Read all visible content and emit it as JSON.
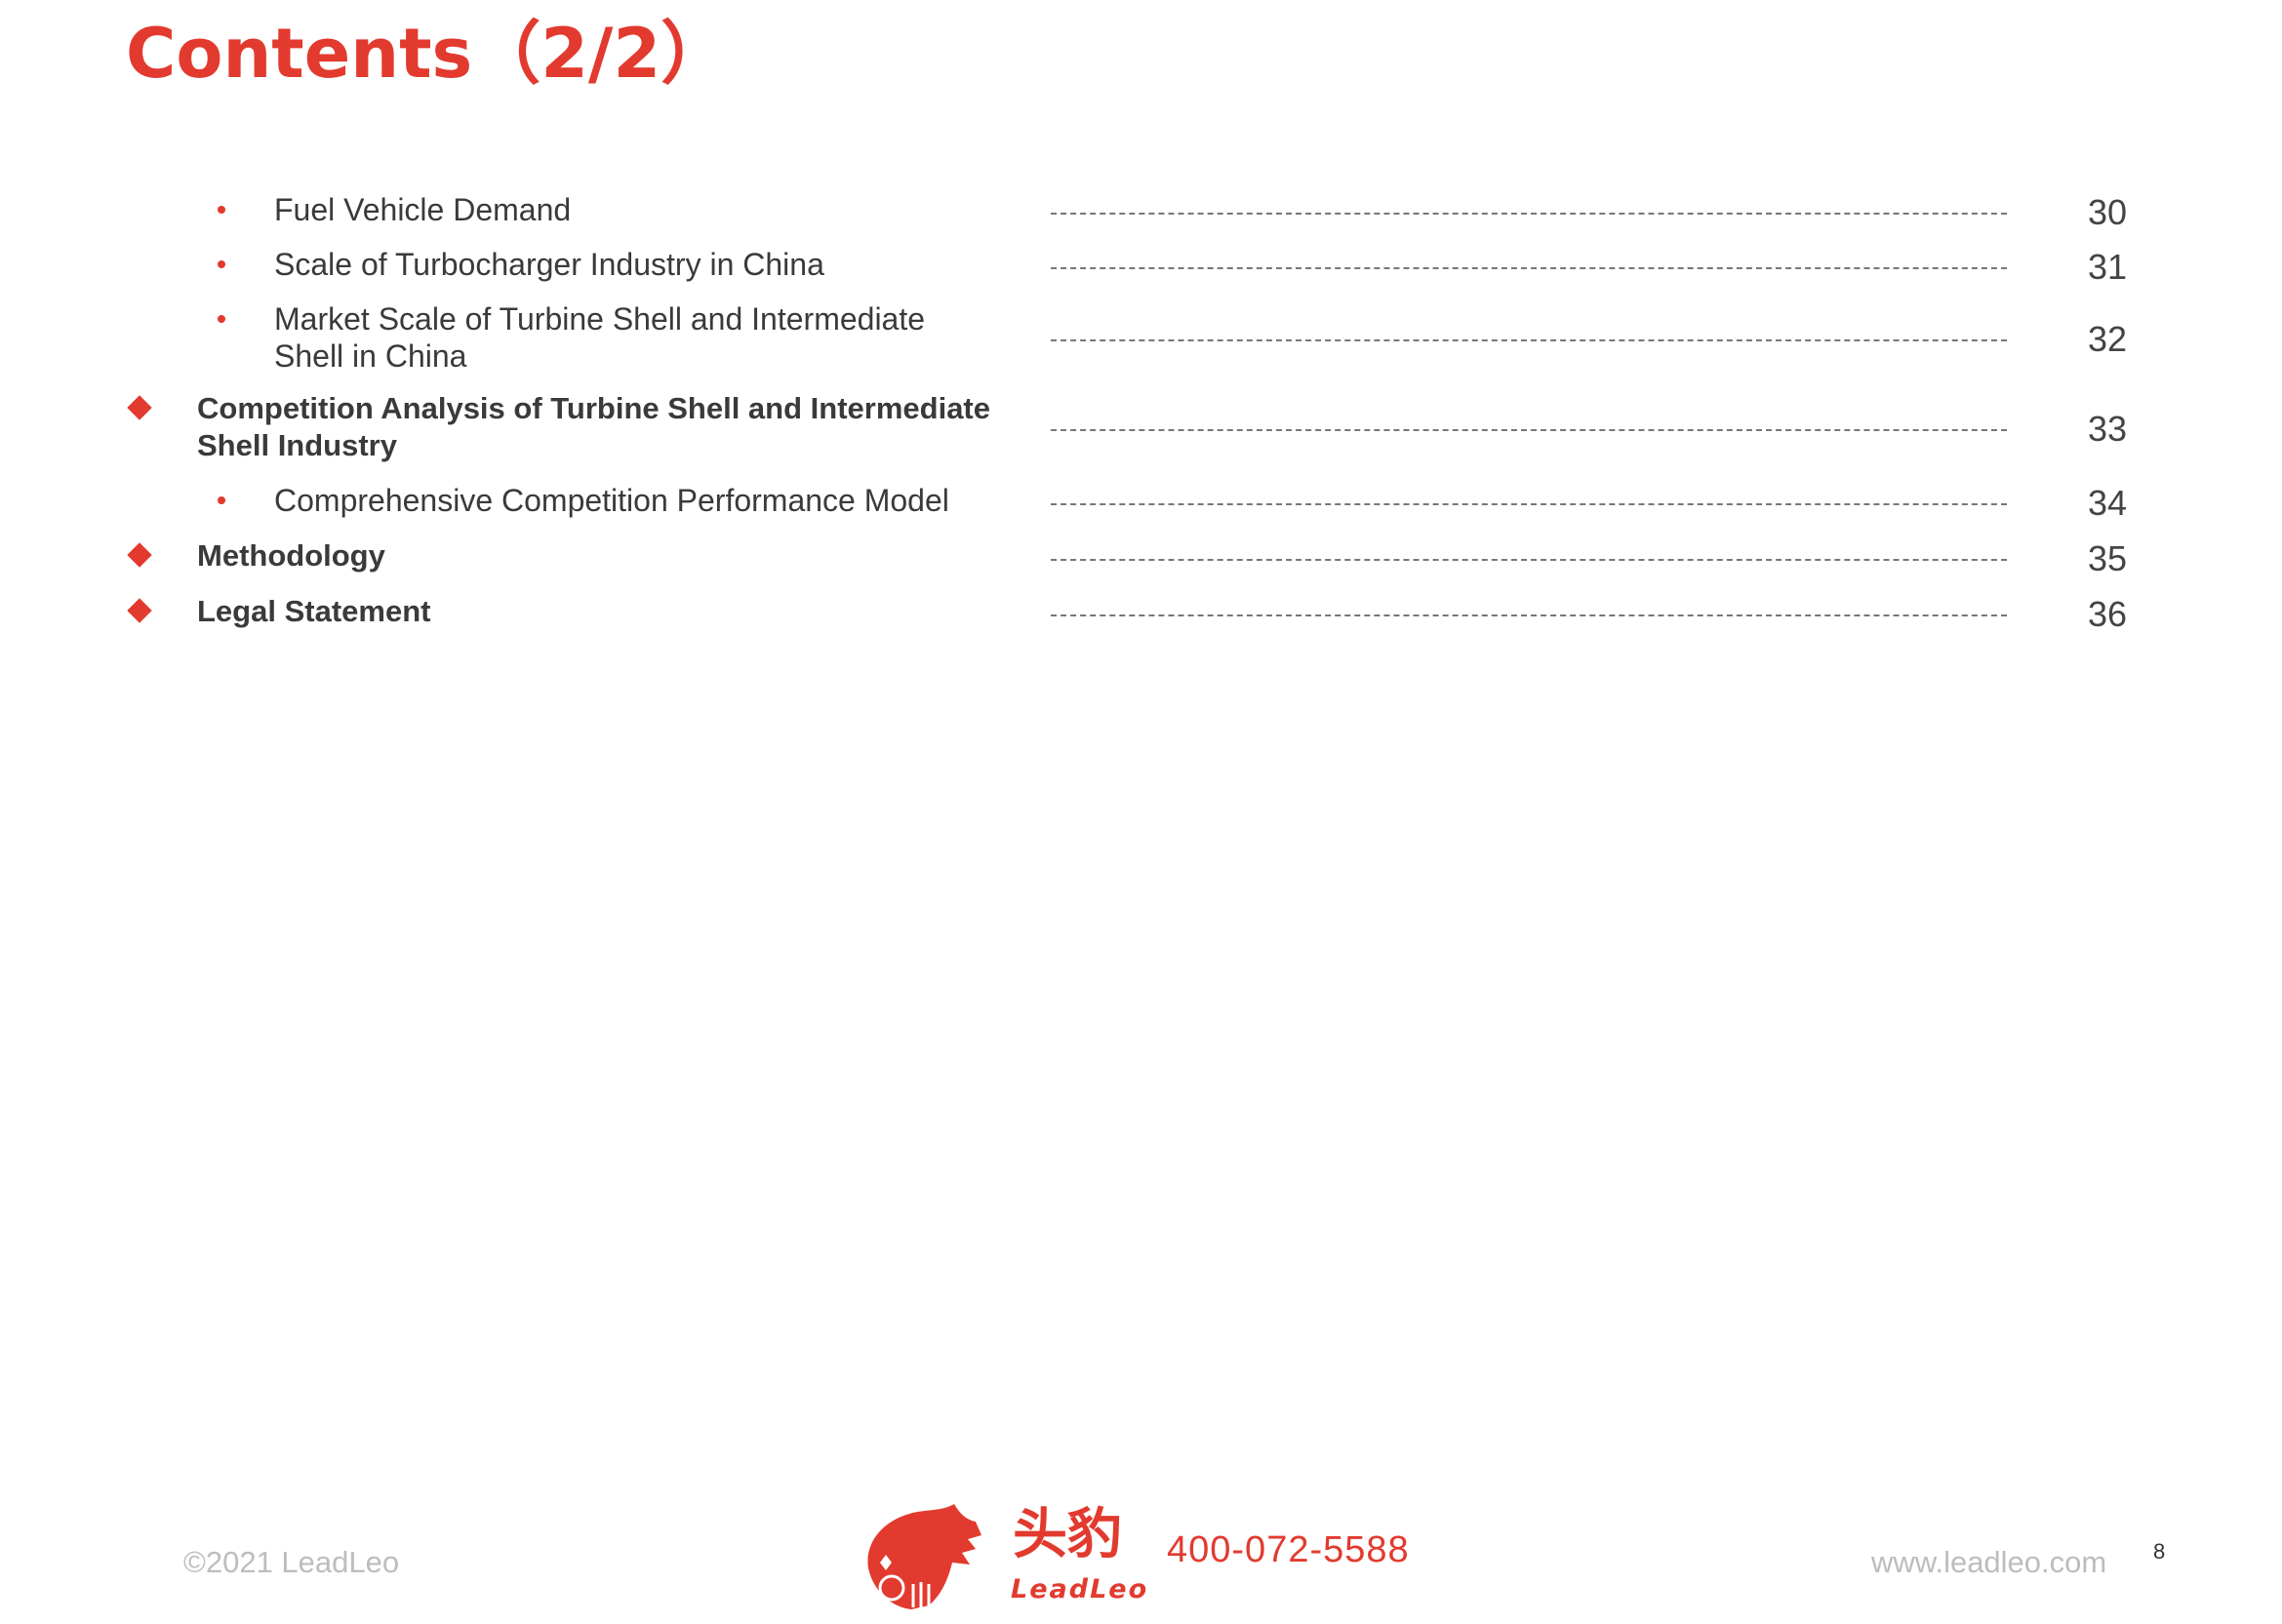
{
  "header": {
    "title": "Contents（2/2）"
  },
  "toc": {
    "items": [
      {
        "level": "sub",
        "label": "Fuel Vehicle Demand",
        "page": "30"
      },
      {
        "level": "sub",
        "label": "Scale of Turbocharger Industry in China",
        "page": "31"
      },
      {
        "level": "sub",
        "label": "Market Scale of Turbine Shell and Intermediate Shell in China",
        "page": "32"
      },
      {
        "level": "main",
        "label": "Competition Analysis of Turbine Shell and Intermediate Shell Industry",
        "page": "33"
      },
      {
        "level": "sub",
        "label": "Comprehensive Competition Performance Model",
        "page": "34"
      },
      {
        "level": "main",
        "label": "Methodology",
        "page": "35"
      },
      {
        "level": "main",
        "label": "Legal Statement",
        "page": "36"
      }
    ]
  },
  "footer": {
    "copyright": "©2021 LeadLeo",
    "logo_cn": "头豹",
    "logo_en": "LeadLeo",
    "phone": "400-072-5588",
    "website": "www.leadleo.com",
    "page_number": "8"
  },
  "colors": {
    "accent": "#e23a2e",
    "text": "#3a3a3a",
    "muted": "#bdbdbd"
  }
}
